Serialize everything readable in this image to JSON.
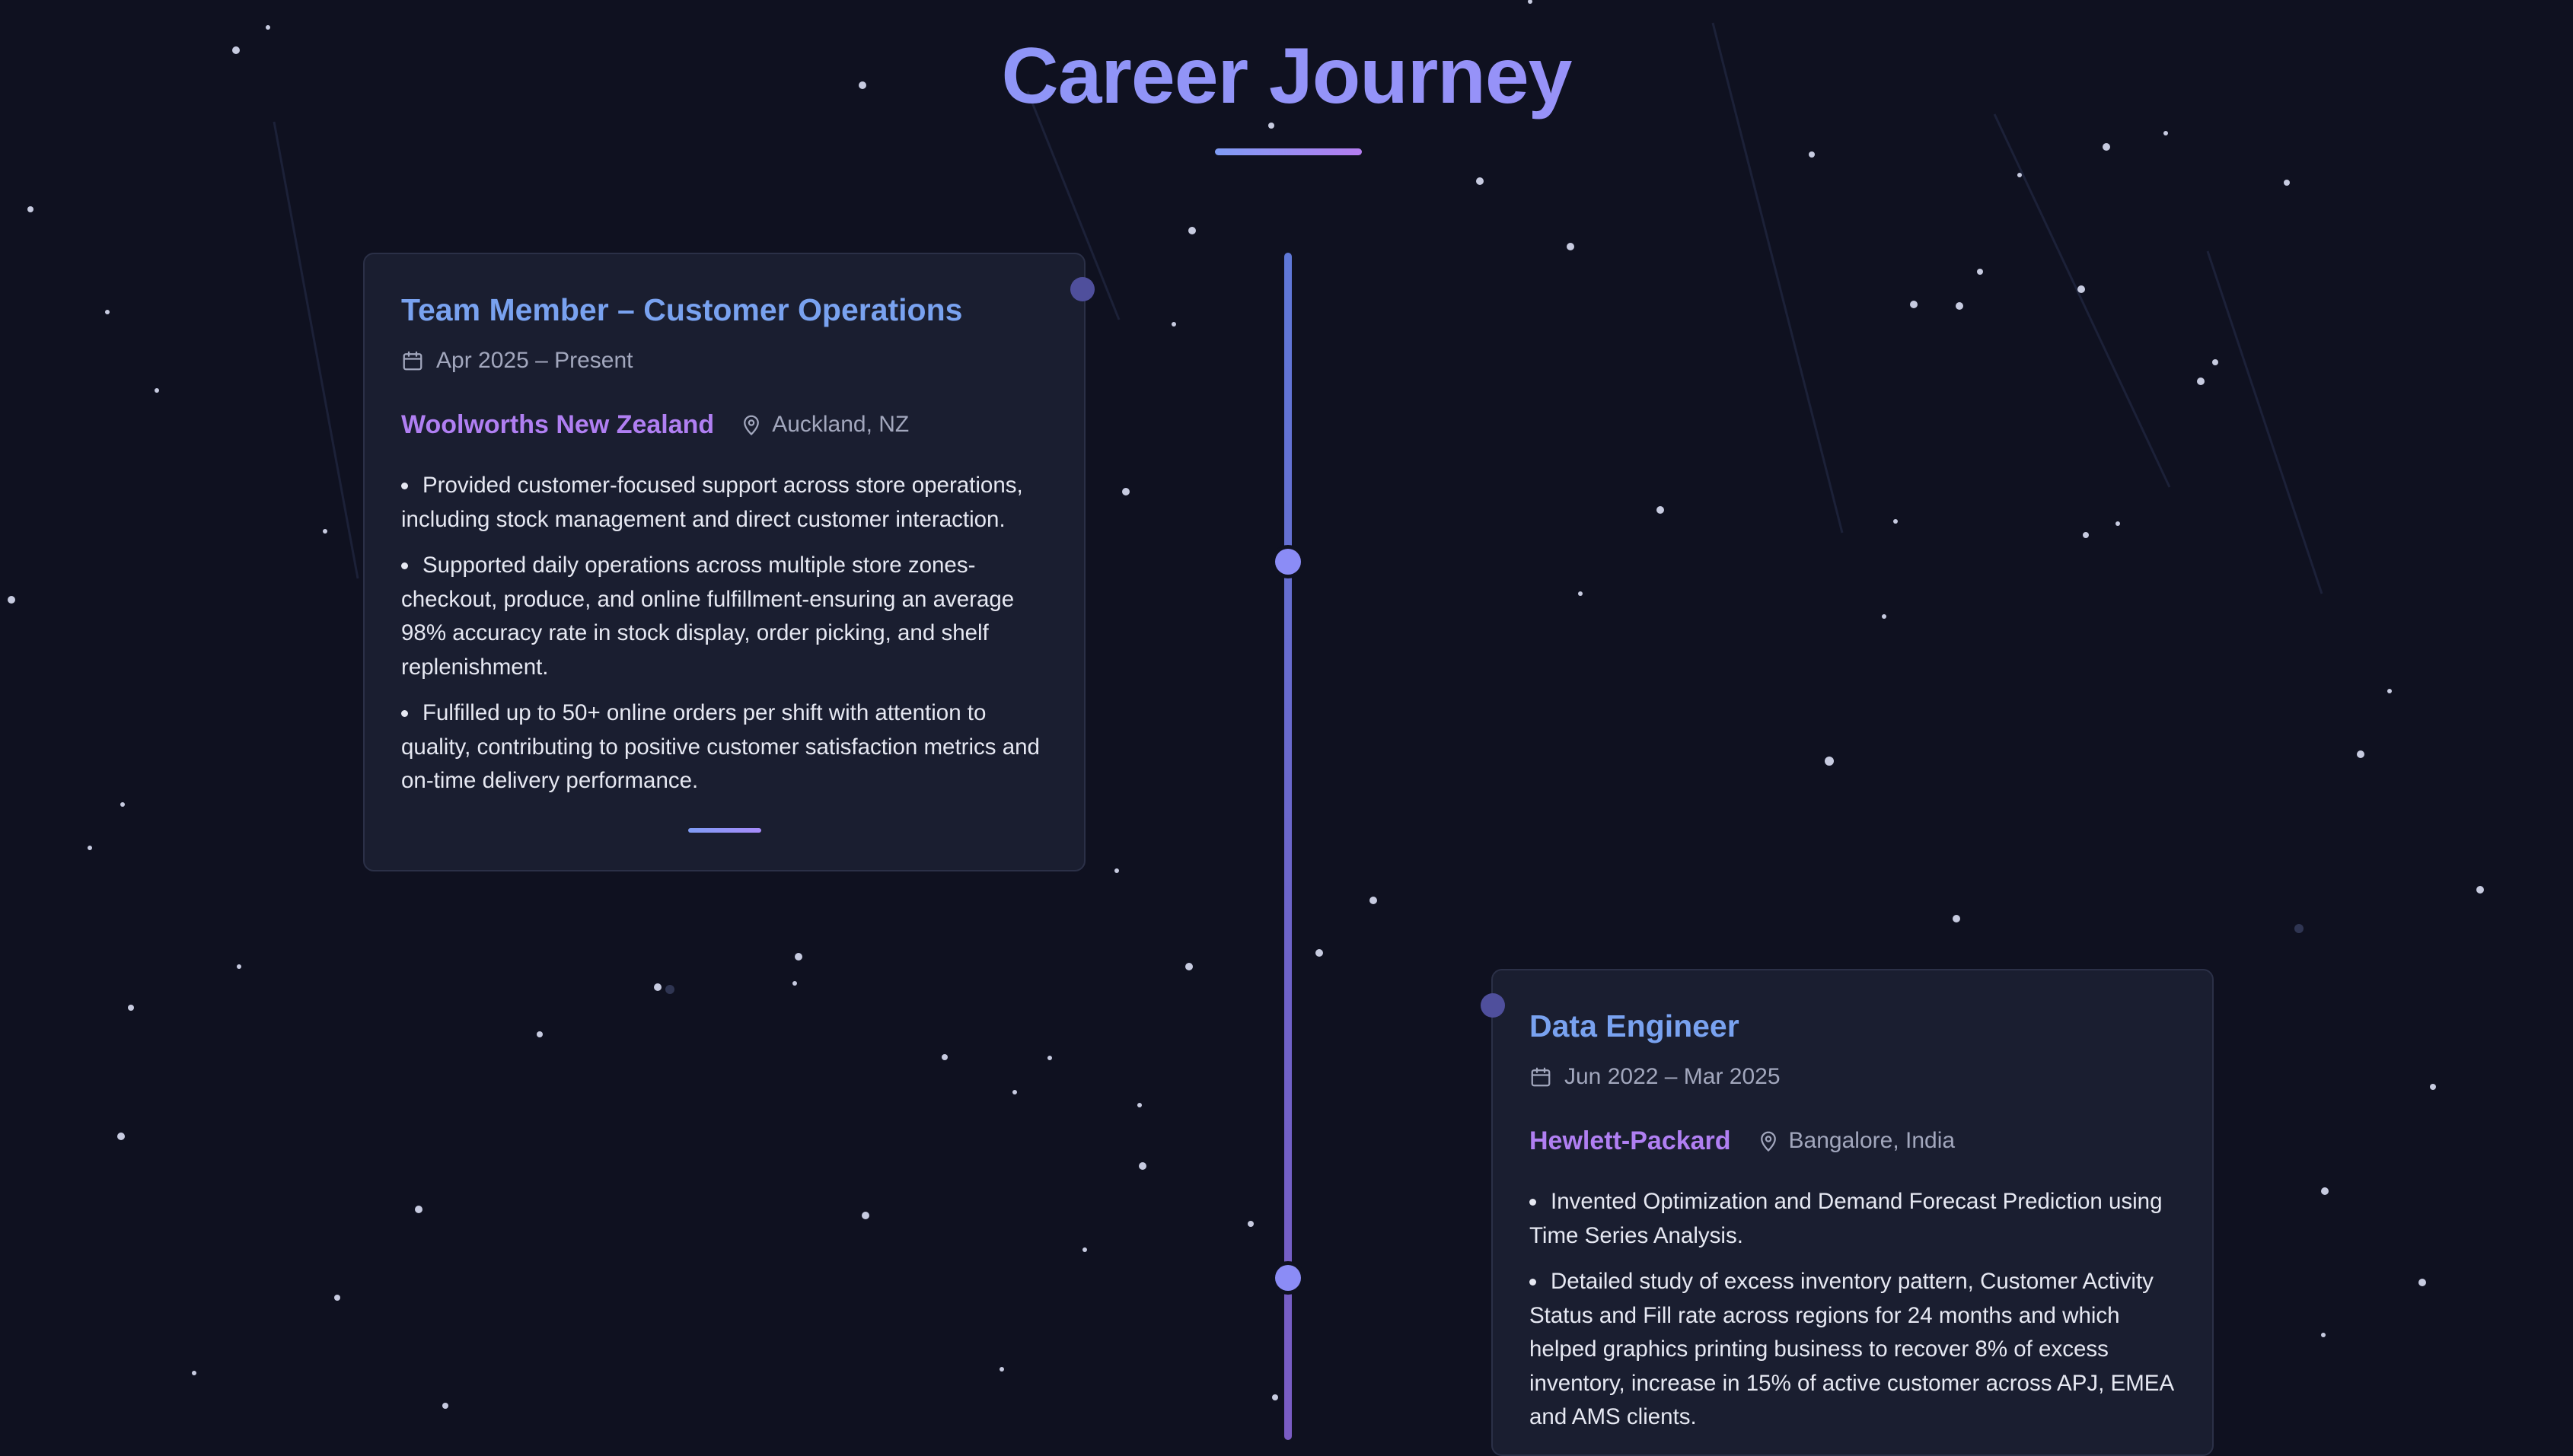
{
  "page": {
    "title": "Career Journey"
  },
  "theme": {
    "background": "#0f1120",
    "card_background": "#1a1e30",
    "accent_blue": "#79a2f0",
    "accent_purple": "#b07ff2",
    "timeline_color": "#6e63c8"
  },
  "icons": {
    "date": "calendar-icon",
    "location": "map-pin-icon"
  },
  "experiences": [
    {
      "title": "Team Member – Customer Operations",
      "dates": "Apr 2025 – Present",
      "company": "Woolworths New Zealand",
      "location": "Auckland, NZ",
      "bullets": [
        "Provided customer-focused support across store operations, including stock management and direct customer interaction.",
        "Supported daily operations across multiple store zones-checkout, produce, and online fulfillment-ensuring an average 98% accuracy rate in stock display, order picking, and shelf replenishment.",
        "Fulfilled up to 50+ online orders per shift with attention to quality, contributing to positive customer satisfaction metrics and on-time delivery performance."
      ]
    },
    {
      "title": "Data Engineer",
      "dates": "Jun 2022 – Mar 2025",
      "company": "Hewlett-Packard",
      "location": "Bangalore, India",
      "bullets": [
        "Invented Optimization and Demand Forecast Prediction using Time Series Analysis.",
        "Detailed study of excess inventory pattern, Customer Activity Status and Fill rate across regions for 24 months and which helped graphics printing business to recover 8% of excess inventory, increase in 15% of active customer across APJ, EMEA and AMS clients."
      ]
    }
  ]
}
